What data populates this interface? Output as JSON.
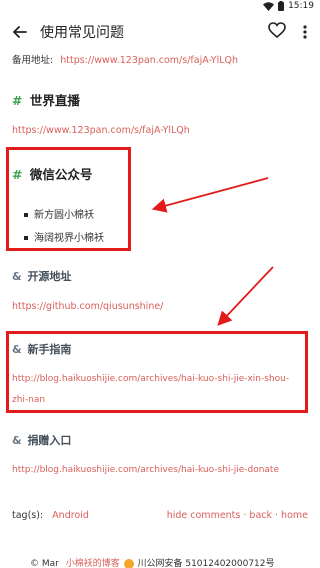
{
  "status": {
    "time": "15:19"
  },
  "appbar": {
    "title": "使用常见问题"
  },
  "backup": {
    "label": "备用地址:",
    "url": "https://www.123pan.com/s/fajA-YlLQh"
  },
  "sections": {
    "live": {
      "hash": "#",
      "title": "世界直播",
      "url": "https://www.123pan.com/s/fajA-YlLQh"
    },
    "wechat": {
      "hash": "#",
      "title": "微信公众号",
      "items": [
        "新方圆小棉袄",
        "海阔视界小棉袄"
      ]
    },
    "opensource": {
      "amp": "&",
      "title": "开源地址",
      "url": "https://github.com/qiusunshine/"
    },
    "guide": {
      "amp": "&",
      "title": "新手指南",
      "url_line1": "http://blog.haikuoshijie.com/archives/hai-kuo-shi-jie-xin-shou-",
      "url_line2": "zhi-nan"
    },
    "donate": {
      "amp": "&",
      "title": "捐赠入口",
      "url": "http://blog.haikuoshijie.com/archives/hai-kuo-shi-jie-donate"
    }
  },
  "tags": {
    "label": "tag(s):",
    "tag": "Android",
    "links": "hide comments · back · home"
  },
  "footer": {
    "prefix": "© Mar",
    "blog": "小棉袄的博客",
    "icp": "川公网安备 51012402000712号"
  },
  "colors": {
    "link": "#d9605a",
    "hash": "#3aa24e",
    "annotation": "#e31b1b"
  }
}
